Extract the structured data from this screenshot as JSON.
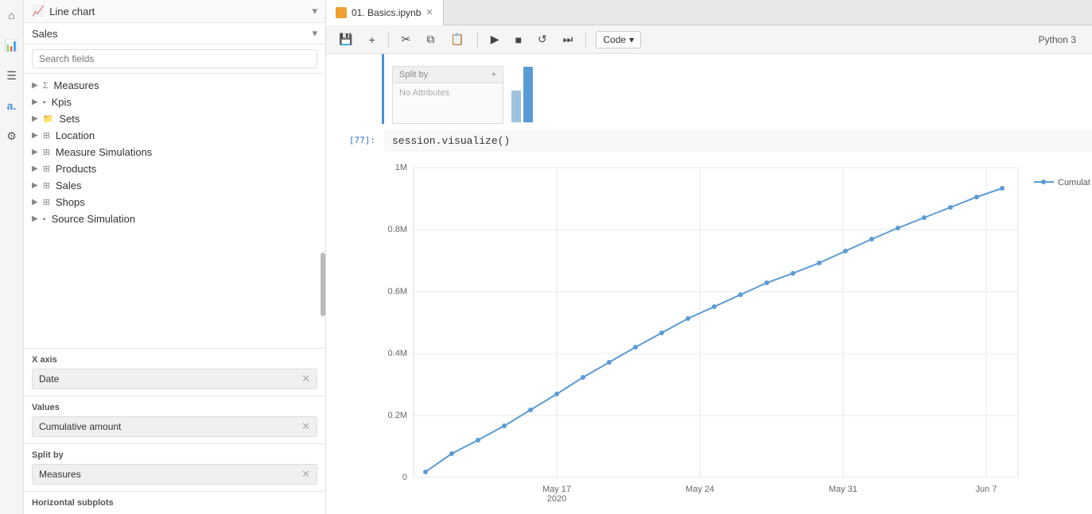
{
  "sidebar": {
    "chart_type": "Line chart",
    "datasource": "Sales",
    "search_placeholder": "Search fields",
    "tree_items": [
      {
        "id": "measures",
        "label": "Measures",
        "icon": "sigma",
        "level": 0
      },
      {
        "id": "kpis",
        "label": "Kpis",
        "icon": "box",
        "level": 0
      },
      {
        "id": "sets",
        "label": "Sets",
        "icon": "folder",
        "level": 0
      },
      {
        "id": "location",
        "label": "Location",
        "icon": "table",
        "level": 0
      },
      {
        "id": "measure_simulations",
        "label": "Measure Simulations",
        "icon": "table",
        "level": 0
      },
      {
        "id": "products",
        "label": "Products",
        "icon": "table",
        "level": 0
      },
      {
        "id": "sales",
        "label": "Sales",
        "icon": "table",
        "level": 0
      },
      {
        "id": "shops",
        "label": "Shops",
        "icon": "table",
        "level": 0
      },
      {
        "id": "source_simulation",
        "label": "Source Simulation",
        "icon": "box",
        "level": 0
      }
    ],
    "xaxis_label": "X axis",
    "xaxis_field": "Date",
    "values_label": "Values",
    "values_field": "Cumulative amount",
    "split_by_label": "Split by",
    "split_by_field": "Measures",
    "horizontal_subplots_label": "Horizontal subplots"
  },
  "notebook": {
    "tab_label": "01. Basics.ipynb",
    "python_badge": "Python 3",
    "toolbar": {
      "save": "💾",
      "add": "+",
      "cut": "✂",
      "copy": "⧉",
      "paste": "📋",
      "run": "▶",
      "stop": "■",
      "restart": "↺",
      "fast_forward": "⏭",
      "code_label": "Code"
    },
    "cell_number": "[77]:",
    "code": "session.visualize()",
    "split_by_header": "Split by",
    "no_attributes": "No Attributes",
    "chart": {
      "legend_label": "Cumulative amount",
      "x_labels": [
        "May 17\n2020",
        "May 24",
        "May 31",
        "Jun 7"
      ],
      "y_labels": [
        "0",
        "0.2M",
        "0.4M",
        "0.6M",
        "0.8M",
        "1M"
      ],
      "data_points": [
        [
          0,
          5
        ],
        [
          1,
          25
        ],
        [
          2,
          60
        ],
        [
          3,
          100
        ],
        [
          4,
          145
        ],
        [
          5,
          195
        ],
        [
          6,
          250
        ],
        [
          7,
          305
        ],
        [
          8,
          360
        ],
        [
          9,
          415
        ],
        [
          10,
          470
        ],
        [
          11,
          520
        ],
        [
          12,
          565
        ],
        [
          13,
          610
        ],
        [
          14,
          650
        ],
        [
          15,
          695
        ],
        [
          16,
          745
        ],
        [
          17,
          790
        ],
        [
          18,
          835
        ],
        [
          19,
          875
        ],
        [
          20,
          915
        ],
        [
          21,
          960
        ],
        [
          22,
          990
        ]
      ]
    }
  },
  "colors": {
    "accent_blue": "#4a90d9",
    "line_blue": "#5b9bd5",
    "tab_icon_orange": "#f0a030"
  }
}
